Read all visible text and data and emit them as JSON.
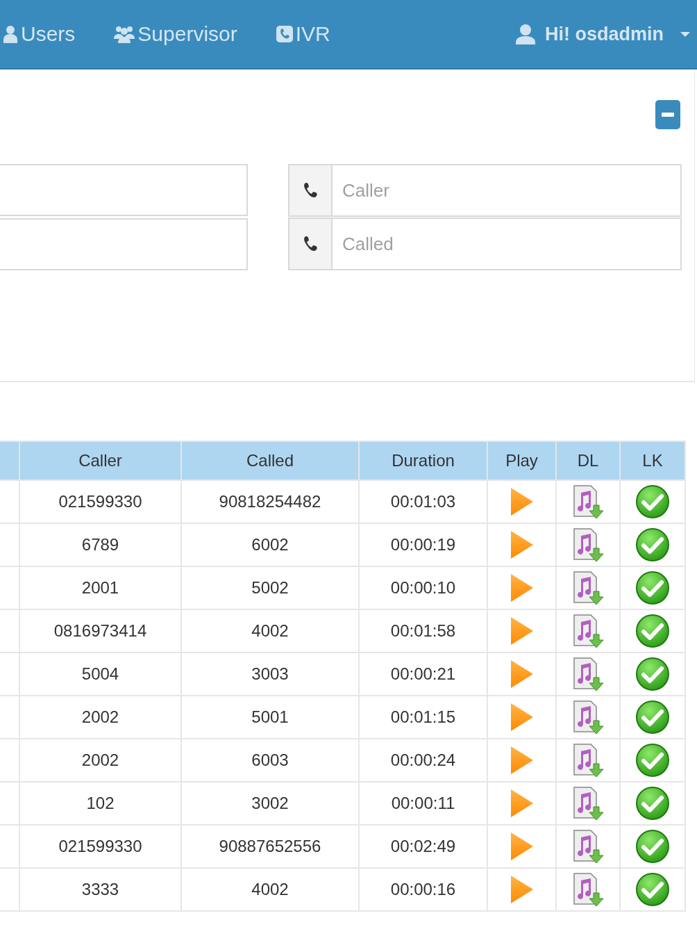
{
  "nav": {
    "items": [
      {
        "label": "Users",
        "kind": "user"
      },
      {
        "label": "Supervisor",
        "kind": "group"
      },
      {
        "label": "IVR",
        "kind": "phone"
      }
    ],
    "user_menu": {
      "label": "Hi! osdadmin"
    }
  },
  "filter": {
    "fields": [
      {
        "placeholder": "Caller"
      },
      {
        "placeholder": "Called"
      }
    ]
  },
  "table": {
    "columns": [
      "Caller",
      "Called",
      "Duration",
      "Play",
      "DL",
      "LK"
    ],
    "rows": [
      {
        "caller": "021599330",
        "called": "90818254482",
        "duration": "00:01:03"
      },
      {
        "caller": "6789",
        "called": "6002",
        "duration": "00:00:19"
      },
      {
        "caller": "2001",
        "called": "5002",
        "duration": "00:00:10"
      },
      {
        "caller": "0816973414",
        "called": "4002",
        "duration": "00:01:58"
      },
      {
        "caller": "5004",
        "called": "3003",
        "duration": "00:00:21"
      },
      {
        "caller": "2002",
        "called": "5001",
        "duration": "00:01:15"
      },
      {
        "caller": "2002",
        "called": "6003",
        "duration": "00:00:24"
      },
      {
        "caller": "102",
        "called": "3002",
        "duration": "00:00:11"
      },
      {
        "caller": "021599330",
        "called": "90887652556",
        "duration": "00:02:49"
      },
      {
        "caller": "3333",
        "called": "4002",
        "duration": "00:00:16"
      }
    ]
  }
}
